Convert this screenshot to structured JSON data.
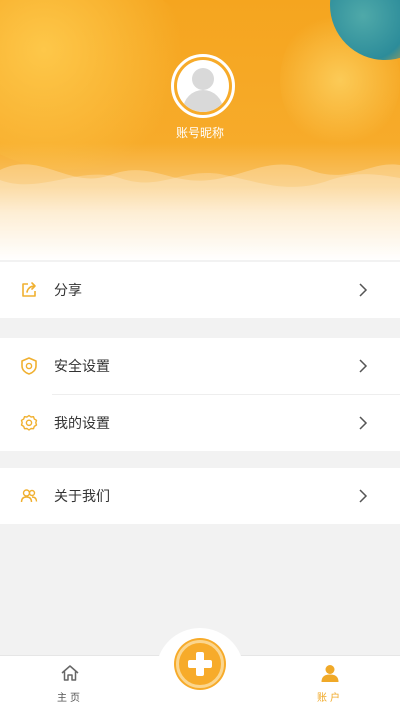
{
  "profile": {
    "nickname": "账号昵称"
  },
  "menu": {
    "share": "分享",
    "security": "安全设置",
    "my_settings": "我的设置",
    "about": "关于我们"
  },
  "tabbar": {
    "home": "主页",
    "account": "账户"
  },
  "colors": {
    "accent": "#f7ab2a",
    "icon": "#f0b030"
  },
  "icons": {
    "share": "share-icon",
    "security": "shield-icon",
    "settings": "gear-icon",
    "about": "users-icon",
    "chevron": "chevron-right-icon",
    "home": "home-icon",
    "add": "plus-icon",
    "account": "person-icon"
  }
}
